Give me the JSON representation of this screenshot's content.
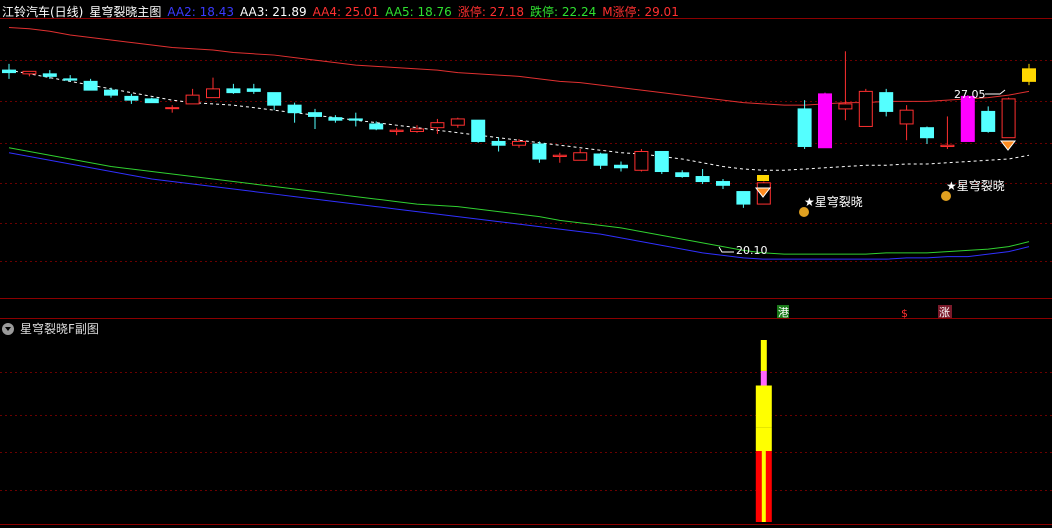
{
  "header": {
    "stock": "江铃汽车(日线)",
    "main_indicator": "星穹裂晓主图",
    "values": [
      {
        "label": "AA2: 18.43",
        "color": "#3a3aff"
      },
      {
        "label": "AA3: 21.89",
        "color": "#ffffff"
      },
      {
        "label": "AA4: 25.01",
        "color": "#ff3030"
      },
      {
        "label": "AA5: 18.76",
        "color": "#30e030"
      },
      {
        "label": "涨停: 27.18",
        "color": "#ff3030"
      },
      {
        "label": "跌停: 22.24",
        "color": "#30e030"
      },
      {
        "label": "M涨停: 29.01",
        "color": "#ff3030"
      }
    ]
  },
  "sub_panel": {
    "title": "星穹裂晓F副图"
  },
  "annotations": {
    "high_label": "27.05",
    "low_label": "20.10",
    "signal_1": "星穹裂晓",
    "signal_2": "星穹裂晓",
    "tag_gang": "港",
    "tag_s": "$",
    "tag_zhang": "涨"
  },
  "chart_data": {
    "type": "candlestick",
    "y_range": [
      17.2,
      28.3
    ],
    "candles": [
      {
        "o": 26.3,
        "h": 26.55,
        "l": 25.95,
        "c": 26.2
      },
      {
        "o": 26.15,
        "h": 26.25,
        "l": 26.05,
        "c": 26.25
      },
      {
        "o": 26.15,
        "h": 26.3,
        "l": 25.95,
        "c": 26.05
      },
      {
        "o": 25.95,
        "h": 26.1,
        "l": 25.85,
        "c": 25.9
      },
      {
        "o": 25.85,
        "h": 25.95,
        "l": 25.5,
        "c": 25.5
      },
      {
        "o": 25.5,
        "h": 25.6,
        "l": 25.2,
        "c": 25.3
      },
      {
        "o": 25.25,
        "h": 25.35,
        "l": 24.95,
        "c": 25.1
      },
      {
        "o": 25.15,
        "h": 25.2,
        "l": 25.0,
        "c": 25.0
      },
      {
        "o": 24.8,
        "h": 24.9,
        "l": 24.6,
        "c": 24.8
      },
      {
        "o": 24.95,
        "h": 25.55,
        "l": 24.95,
        "c": 25.3
      },
      {
        "o": 25.2,
        "h": 26.0,
        "l": 25.2,
        "c": 25.55
      },
      {
        "o": 25.55,
        "h": 25.75,
        "l": 25.35,
        "c": 25.4
      },
      {
        "o": 25.55,
        "h": 25.75,
        "l": 25.35,
        "c": 25.45
      },
      {
        "o": 25.4,
        "h": 25.4,
        "l": 24.7,
        "c": 24.9
      },
      {
        "o": 24.9,
        "h": 25.0,
        "l": 24.2,
        "c": 24.6
      },
      {
        "o": 24.6,
        "h": 24.75,
        "l": 23.95,
        "c": 24.45
      },
      {
        "o": 24.4,
        "h": 24.5,
        "l": 24.2,
        "c": 24.3
      },
      {
        "o": 24.35,
        "h": 24.6,
        "l": 24.05,
        "c": 24.3
      },
      {
        "o": 24.15,
        "h": 24.25,
        "l": 23.9,
        "c": 23.95
      },
      {
        "o": 23.85,
        "h": 24.0,
        "l": 23.7,
        "c": 23.9
      },
      {
        "o": 23.85,
        "h": 24.1,
        "l": 23.8,
        "c": 23.95
      },
      {
        "o": 24.0,
        "h": 24.35,
        "l": 23.75,
        "c": 24.2
      },
      {
        "o": 24.1,
        "h": 24.4,
        "l": 24.0,
        "c": 24.35
      },
      {
        "o": 24.3,
        "h": 24.3,
        "l": 23.4,
        "c": 23.45
      },
      {
        "o": 23.45,
        "h": 23.6,
        "l": 23.05,
        "c": 23.3
      },
      {
        "o": 23.3,
        "h": 23.55,
        "l": 23.2,
        "c": 23.45
      },
      {
        "o": 23.35,
        "h": 23.45,
        "l": 22.6,
        "c": 22.75
      },
      {
        "o": 22.85,
        "h": 23.0,
        "l": 22.6,
        "c": 22.9
      },
      {
        "o": 22.7,
        "h": 23.15,
        "l": 22.7,
        "c": 23.0
      },
      {
        "o": 22.95,
        "h": 23.0,
        "l": 22.35,
        "c": 22.5
      },
      {
        "o": 22.5,
        "h": 22.65,
        "l": 22.25,
        "c": 22.4
      },
      {
        "o": 22.3,
        "h": 23.15,
        "l": 22.25,
        "c": 23.05
      },
      {
        "o": 23.05,
        "h": 23.05,
        "l": 22.15,
        "c": 22.25
      },
      {
        "o": 22.2,
        "h": 22.3,
        "l": 22.0,
        "c": 22.05
      },
      {
        "o": 22.05,
        "h": 22.35,
        "l": 21.75,
        "c": 21.85
      },
      {
        "o": 21.85,
        "h": 21.95,
        "l": 21.55,
        "c": 21.7
      },
      {
        "o": 21.45,
        "h": 21.45,
        "l": 20.8,
        "c": 20.95
      },
      {
        "o": 20.95,
        "h": 21.85,
        "l": 20.95,
        "c": 21.8
      },
      {
        "o": null
      },
      {
        "o": 24.75,
        "h": 25.1,
        "l": 23.15,
        "c": 23.25
      },
      {
        "o": 23.2,
        "h": 25.4,
        "l": 23.2,
        "c": 25.35
      },
      {
        "o": 24.75,
        "h": 27.05,
        "l": 24.3,
        "c": 24.95
      },
      {
        "o": 24.05,
        "h": 25.55,
        "l": 24.05,
        "c": 25.45
      },
      {
        "o": 25.4,
        "h": 25.55,
        "l": 24.45,
        "c": 24.65
      },
      {
        "o": 24.15,
        "h": 24.9,
        "l": 23.5,
        "c": 24.7
      },
      {
        "o": 24.0,
        "h": 24.05,
        "l": 23.35,
        "c": 23.6
      },
      {
        "o": 23.25,
        "h": 24.45,
        "l": 23.15,
        "c": 23.3
      },
      {
        "o": 23.45,
        "h": 25.3,
        "l": 23.45,
        "c": 25.25
      },
      {
        "o": 24.65,
        "h": 24.85,
        "l": 23.8,
        "c": 23.85
      },
      {
        "o": 23.6,
        "h": 25.2,
        "l": 23.6,
        "c": 25.15
      },
      {
        "o": 25.85,
        "h": 26.55,
        "l": 25.7,
        "c": 26.35
      }
    ],
    "special_colors": {
      "40": "#ff00ff",
      "47": "#ff00ff",
      "50": "#ffd700"
    },
    "ma_red": [
      28.0,
      27.95,
      27.85,
      27.7,
      27.6,
      27.5,
      27.4,
      27.3,
      27.2,
      27.15,
      27.1,
      27.0,
      26.95,
      26.9,
      26.8,
      26.7,
      26.6,
      26.5,
      26.45,
      26.4,
      26.35,
      26.3,
      26.2,
      26.15,
      26.1,
      26.05,
      25.95,
      25.85,
      25.8,
      25.7,
      25.6,
      25.5,
      25.4,
      25.3,
      25.2,
      25.1,
      25.0,
      24.95,
      24.9,
      24.9,
      24.95,
      25.0,
      25.0,
      25.05,
      25.05,
      25.05,
      25.1,
      25.15,
      25.2,
      25.3,
      25.45
    ],
    "ma_white": [
      26.3,
      26.15,
      26.0,
      25.85,
      25.7,
      25.55,
      25.4,
      25.25,
      25.1,
      25.0,
      24.95,
      24.9,
      24.8,
      24.7,
      24.6,
      24.5,
      24.4,
      24.3,
      24.2,
      24.1,
      24.0,
      23.9,
      23.8,
      23.7,
      23.6,
      23.5,
      23.4,
      23.3,
      23.2,
      23.1,
      23.0,
      22.95,
      22.85,
      22.75,
      22.6,
      22.45,
      22.35,
      22.3,
      22.3,
      22.35,
      22.4,
      22.45,
      22.5,
      22.5,
      22.55,
      22.55,
      22.6,
      22.65,
      22.7,
      22.75,
      22.9
    ],
    "ma_green": [
      23.2,
      23.05,
      22.9,
      22.75,
      22.6,
      22.45,
      22.35,
      22.25,
      22.15,
      22.05,
      21.95,
      21.85,
      21.75,
      21.65,
      21.55,
      21.45,
      21.35,
      21.25,
      21.15,
      21.05,
      20.95,
      20.9,
      20.85,
      20.75,
      20.65,
      20.55,
      20.45,
      20.3,
      20.2,
      20.1,
      20.0,
      19.85,
      19.7,
      19.55,
      19.4,
      19.25,
      19.1,
      19.0,
      18.95,
      18.95,
      18.95,
      18.95,
      18.95,
      19.0,
      19.0,
      19.0,
      19.05,
      19.1,
      19.15,
      19.25,
      19.45
    ],
    "ma_blue": [
      23.0,
      22.85,
      22.7,
      22.55,
      22.4,
      22.25,
      22.1,
      21.95,
      21.85,
      21.75,
      21.65,
      21.55,
      21.45,
      21.35,
      21.25,
      21.15,
      21.05,
      20.95,
      20.85,
      20.75,
      20.65,
      20.55,
      20.45,
      20.35,
      20.25,
      20.15,
      20.05,
      19.95,
      19.85,
      19.75,
      19.6,
      19.45,
      19.3,
      19.15,
      19.0,
      18.9,
      18.8,
      18.75,
      18.75,
      18.75,
      18.75,
      18.75,
      18.75,
      18.75,
      18.8,
      18.8,
      18.85,
      18.85,
      18.95,
      19.05,
      19.25
    ],
    "sub_bars": [
      {
        "index": 37,
        "segments": [
          {
            "from": 0,
            "to": 0.39,
            "color": "#ff0000"
          },
          {
            "from": 0.39,
            "to": 0.52,
            "color": "#ffff00"
          },
          {
            "from": 0.52,
            "to": 0.75,
            "color": "#ffff00"
          },
          {
            "from": 0.75,
            "to": 0.83,
            "color": "#ff66ff"
          },
          {
            "from": 0.83,
            "to": 1.0,
            "color": "#ffff00"
          }
        ]
      }
    ]
  }
}
